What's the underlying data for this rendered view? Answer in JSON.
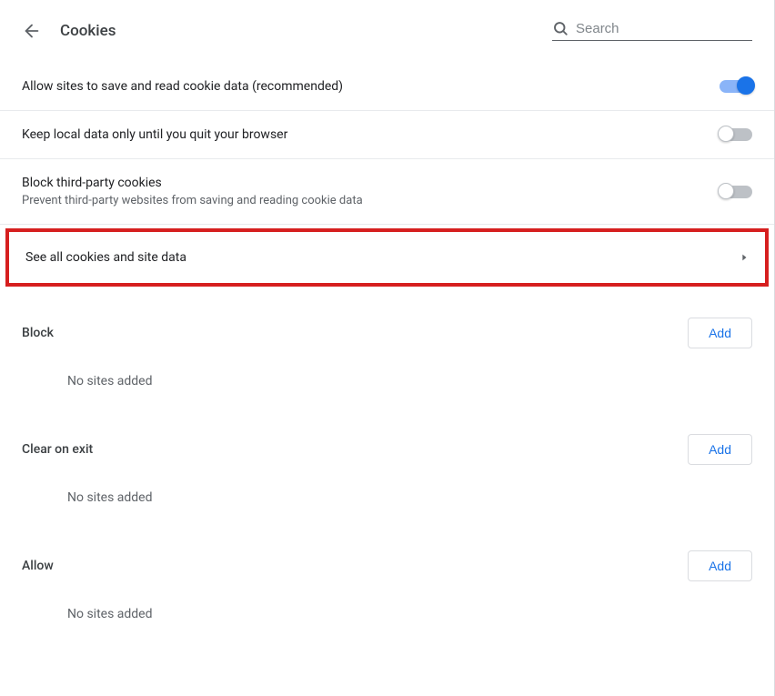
{
  "header": {
    "title": "Cookies",
    "search_placeholder": "Search"
  },
  "settings": {
    "allow_cookies": {
      "label": "Allow sites to save and read cookie data (recommended)"
    },
    "keep_local": {
      "label": "Keep local data only until you quit your browser"
    },
    "block_third_party": {
      "label": "Block third-party cookies",
      "sublabel": "Prevent third-party websites from saving and reading cookie data"
    },
    "see_all": {
      "label": "See all cookies and site data"
    }
  },
  "sections": {
    "block": {
      "title": "Block",
      "add_label": "Add",
      "empty": "No sites added"
    },
    "clear_on_exit": {
      "title": "Clear on exit",
      "add_label": "Add",
      "empty": "No sites added"
    },
    "allow": {
      "title": "Allow",
      "add_label": "Add",
      "empty": "No sites added"
    }
  }
}
